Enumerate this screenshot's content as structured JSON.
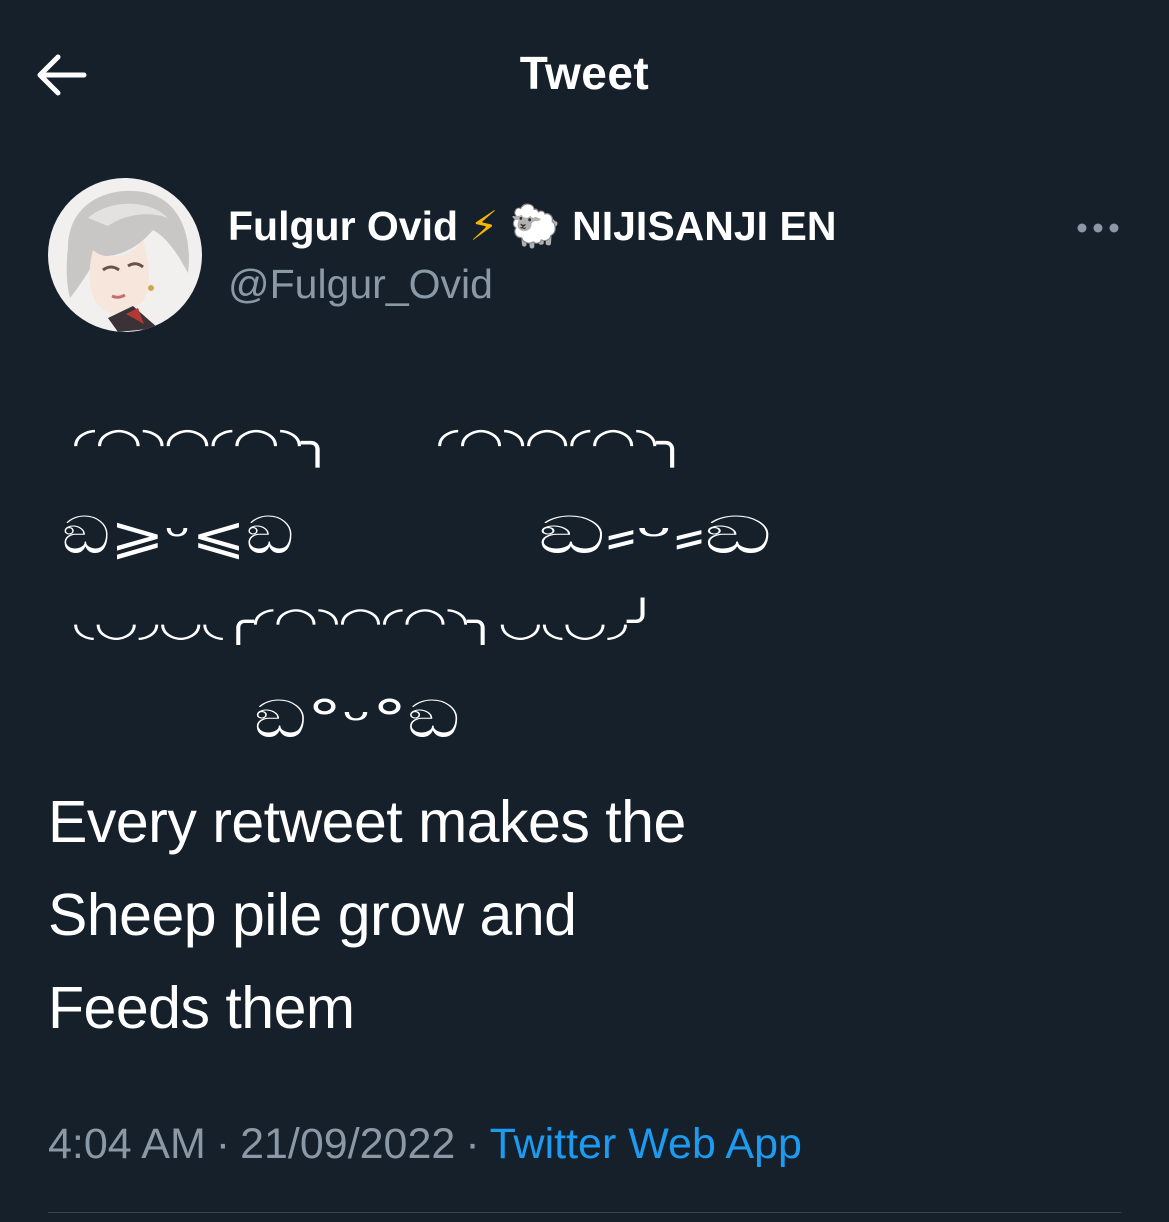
{
  "header": {
    "title": "Tweet",
    "back_icon": "arrow-left-icon"
  },
  "author": {
    "display_name": "Fulgur Ovid",
    "emoji_1": "⚡",
    "emoji_2": "🐑",
    "affiliation": "NIJISANJI EN",
    "handle": "@Fulgur_Ovid",
    "more_icon": "more-horizontal-icon"
  },
  "tweet": {
    "ascii_art": {
      "top_left_wool": "◜◠◝◠◜◠◝╮",
      "top_right_wool": "◜◠◝◠◜◠◝╮",
      "left_face": "ඞ⩾ᵕ⩽ඞ",
      "right_face": "ඞ⸗ᵕ⸗ඞ",
      "bottom_wool": "◟◡◞◡◟╭◜◠◝◠◜◠◝╮◡◟◡◞╯",
      "bottom_face": "ඞ°ᵕ°ඞ"
    },
    "lines": [
      "Every retweet makes the",
      "Sheep pile grow and",
      "Feeds them"
    ],
    "time": "4:04 AM",
    "separator": "·",
    "date": "21/09/2022",
    "source": "Twitter Web App"
  },
  "colors": {
    "background": "#15202b",
    "text": "#ffffff",
    "secondary": "#8b98a5",
    "accent": "#1d9bf0"
  }
}
